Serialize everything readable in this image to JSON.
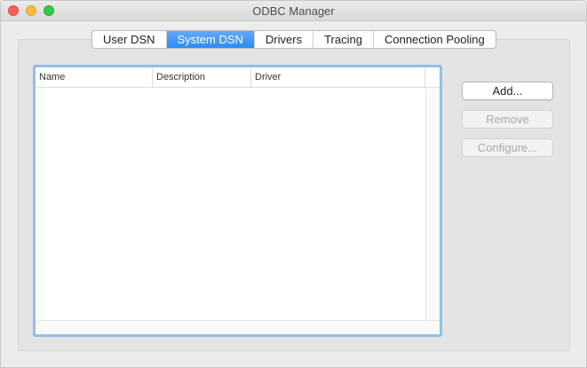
{
  "window": {
    "title": "ODBC Manager"
  },
  "tabs": [
    {
      "label": "User DSN",
      "active": false
    },
    {
      "label": "System DSN",
      "active": true
    },
    {
      "label": "Drivers",
      "active": false
    },
    {
      "label": "Tracing",
      "active": false
    },
    {
      "label": "Connection Pooling",
      "active": false
    }
  ],
  "table": {
    "columns": [
      "Name",
      "Description",
      "Driver"
    ],
    "rows": []
  },
  "buttons": {
    "add": {
      "label": "Add...",
      "enabled": true
    },
    "remove": {
      "label": "Remove",
      "enabled": false
    },
    "configure": {
      "label": "Configure...",
      "enabled": false
    }
  },
  "colors": {
    "accent": "#2b8cf6",
    "focus_ring": "#8fbfe8",
    "close": "#fc605c",
    "minimize": "#fdbc40",
    "zoom": "#34c84a"
  },
  "icons": [
    "close-icon",
    "minimize-icon",
    "zoom-icon"
  ]
}
